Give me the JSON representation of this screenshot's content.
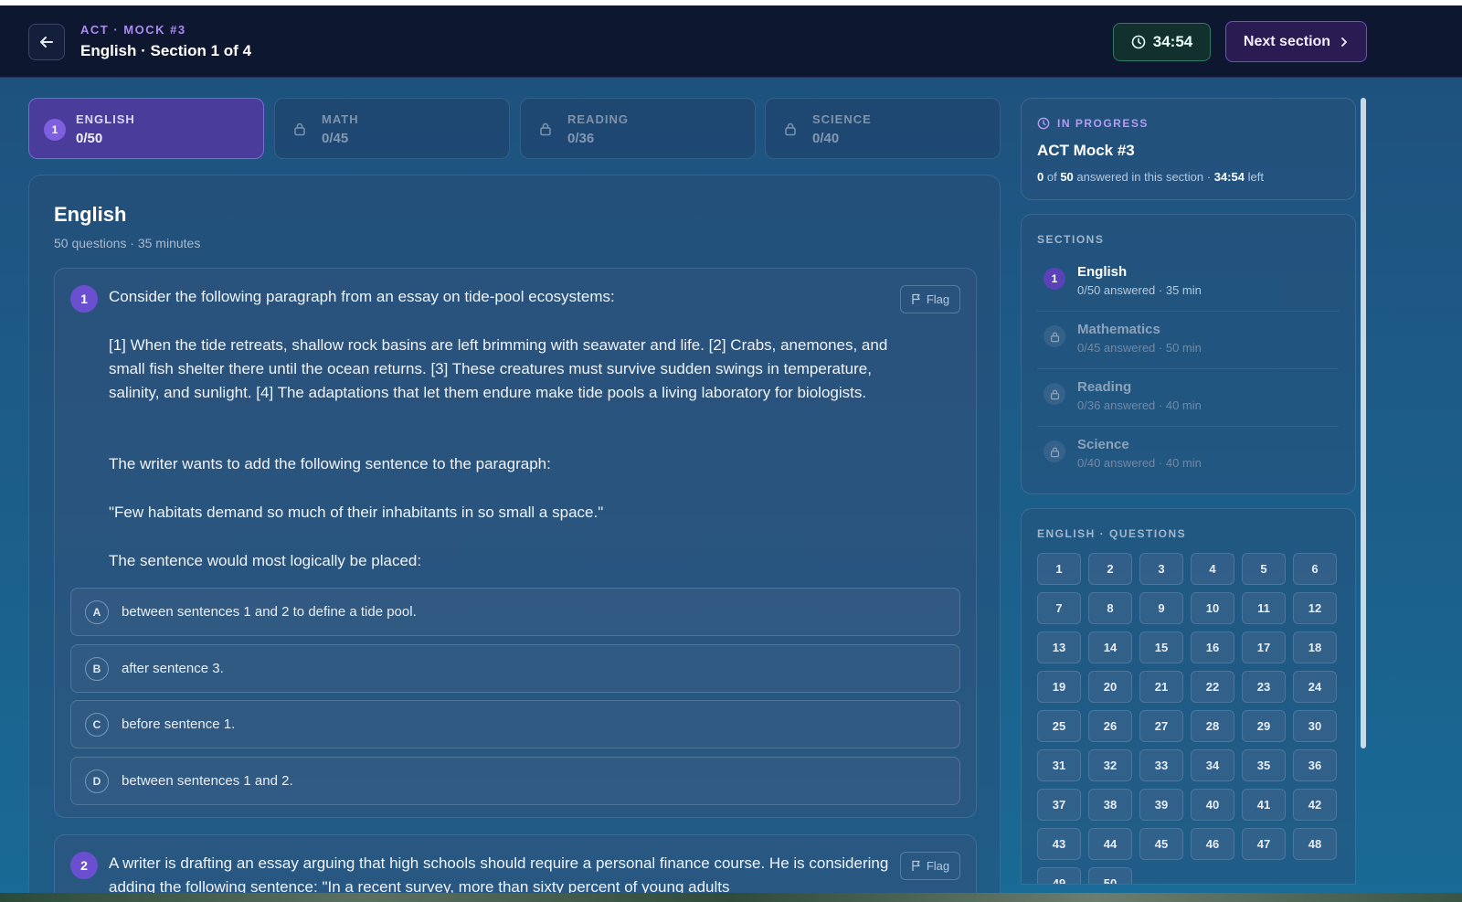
{
  "header": {
    "eyebrow": "ACT · MOCK #3",
    "title": "English · Section 1 of 4",
    "timer": "34:54",
    "next_label": "Next section"
  },
  "tabs": [
    {
      "num": "1",
      "label": "ENGLISH",
      "count": "0/50",
      "state": "active"
    },
    {
      "label": "MATH",
      "count": "0/45",
      "state": "locked"
    },
    {
      "label": "READING",
      "count": "0/36",
      "state": "locked"
    },
    {
      "label": "SCIENCE",
      "count": "0/40",
      "state": "locked"
    }
  ],
  "main": {
    "title": "English",
    "subtitle": "50 questions · 35 minutes",
    "flag_label": "Flag",
    "questions": [
      {
        "num": "1",
        "prompt": "Consider the following paragraph from an essay on tide-pool ecosystems:",
        "passage": "[1] When the tide retreats, shallow rock basins are left brimming with seawater and life. [2] Crabs, anemones, and small fish shelter there until the ocean returns. [3] These creatures must survive sudden swings in temperature, salinity, and sunlight. [4] The adaptations that let them endure make tide pools a living laboratory for biologists.",
        "instruction": "The writer wants to add the following sentence to the paragraph:",
        "quote": "\"Few habitats demand so much of their inhabitants in so small a space.\"",
        "stem": "The sentence would most logically be placed:",
        "options": [
          {
            "letter": "A",
            "text": "between sentences 1 and 2 to define a tide pool."
          },
          {
            "letter": "B",
            "text": "after sentence 3."
          },
          {
            "letter": "C",
            "text": "before sentence 1."
          },
          {
            "letter": "D",
            "text": "between sentences 1 and 2."
          }
        ]
      },
      {
        "num": "2",
        "prompt": "A writer is drafting an essay arguing that high schools should require a personal finance course. He is considering adding the following sentence: \"In a recent survey, more than sixty percent of young adults"
      }
    ]
  },
  "progress": {
    "status": "IN PROGRESS",
    "title": "ACT Mock #3",
    "answered": "0",
    "total": "50",
    "middle_text": "answered in this section ·",
    "time": "34:54",
    "tail": "left"
  },
  "sections": {
    "heading": "SECTIONS",
    "items": [
      {
        "num": "1",
        "name": "English",
        "meta": "0/50 answered · 35 min",
        "state": "active"
      },
      {
        "name": "Mathematics",
        "meta": "0/45 answered · 50 min",
        "state": "locked"
      },
      {
        "name": "Reading",
        "meta": "0/36 answered · 40 min",
        "state": "locked"
      },
      {
        "name": "Science",
        "meta": "0/40 answered · 40 min",
        "state": "locked"
      }
    ]
  },
  "question_grid": {
    "heading": "ENGLISH · QUESTIONS",
    "numbers": [
      "1",
      "2",
      "3",
      "4",
      "5",
      "6",
      "7",
      "8",
      "9",
      "10",
      "11",
      "12",
      "13",
      "14",
      "15",
      "16",
      "17",
      "18",
      "19",
      "20",
      "21",
      "22",
      "23",
      "24",
      "25",
      "26",
      "27",
      "28",
      "29",
      "30",
      "31",
      "32",
      "33",
      "34",
      "35",
      "36",
      "37",
      "38",
      "39",
      "40",
      "41",
      "42",
      "43",
      "44",
      "45",
      "46",
      "47",
      "48",
      "49",
      "50"
    ]
  },
  "colors": {
    "accent": "#6a4fd0",
    "header_bg": "#0e1730",
    "timer_border": "#2e7a62"
  }
}
